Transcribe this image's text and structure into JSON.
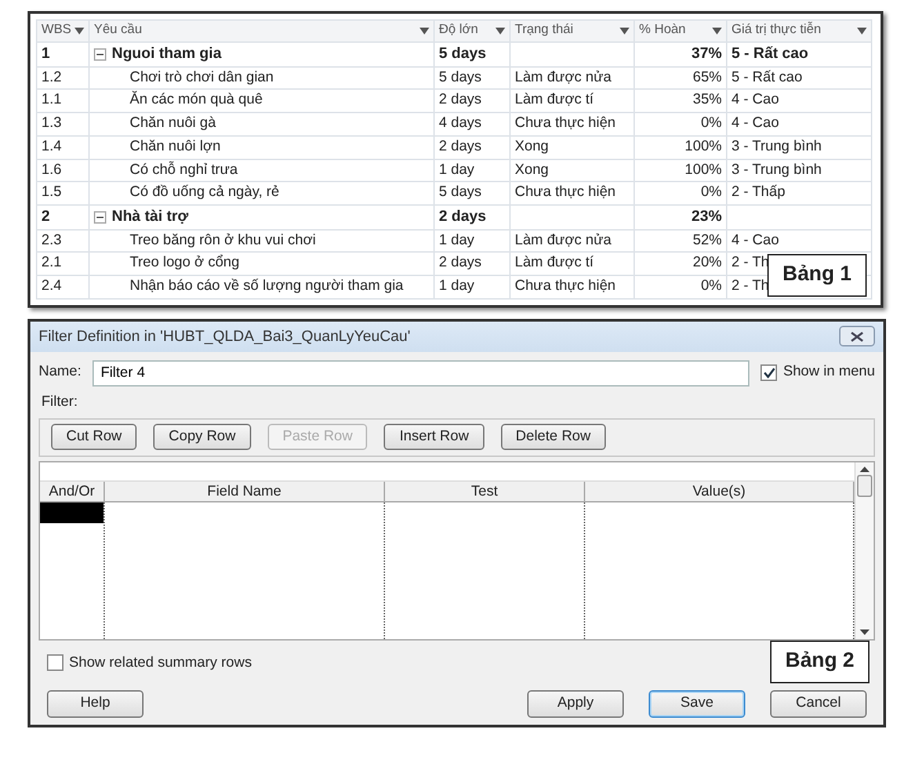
{
  "table": {
    "columns": [
      {
        "label": "WBS"
      },
      {
        "label": "Yêu cầu"
      },
      {
        "label": "Độ lớn"
      },
      {
        "label": "Trạng thái"
      },
      {
        "label": "% Hoàn"
      },
      {
        "label": "Giá trị thực tiễn"
      }
    ],
    "rows": [
      {
        "wbs": "1",
        "name": "Nguoi tham gia",
        "duration": "5 days",
        "complete": "37%",
        "value": "5 - Rất cao",
        "kind": "summary",
        "expanded": true,
        "children": [
          {
            "wbs": "1.2",
            "name": "Chơi trò chơi dân gian",
            "duration": "5 days",
            "status": "Làm được nửa",
            "complete": "65%",
            "value": "5 - Rất cao",
            "kind": "task"
          },
          {
            "wbs": "1.1",
            "name": "Ăn các món quà quê",
            "duration": "2 days",
            "status": "Làm được tí",
            "complete": "35%",
            "value": "4 - Cao",
            "kind": "task"
          },
          {
            "wbs": "1.3",
            "name": "Chăn nuôi gà",
            "duration": "4 days",
            "status": "Chưa thực hiện",
            "complete": "0%",
            "value": "4 - Cao",
            "kind": "task"
          },
          {
            "wbs": "1.4",
            "name": "Chăn nuôi lợn",
            "duration": "2 days",
            "status": "Xong",
            "complete": "100%",
            "value": "3 - Trung bình",
            "kind": "task"
          },
          {
            "wbs": "1.6",
            "name": "Có chỗ nghỉ trưa",
            "duration": "1 day",
            "status": "Xong",
            "complete": "100%",
            "value": "3 - Trung bình",
            "kind": "task"
          },
          {
            "wbs": "1.5",
            "name": "Có đồ uống cả ngày, rẻ",
            "duration": "5 days",
            "status": "Chưa thực hiện",
            "complete": "0%",
            "value": "2 - Thấp",
            "kind": "task"
          }
        ]
      },
      {
        "wbs": "2",
        "name": "Nhà tài trợ",
        "duration": "2 days",
        "complete": "23%",
        "kind": "summary",
        "expanded": true,
        "children": [
          {
            "wbs": "2.3",
            "name": "Treo băng rôn ở khu vui chơi",
            "duration": "1 day",
            "status": "Làm được nửa",
            "complete": "52%",
            "value": "4 - Cao",
            "kind": "task"
          },
          {
            "wbs": "2.1",
            "name": "Treo logo ở cổng",
            "duration": "2 days",
            "status": "Làm được tí",
            "complete": "20%",
            "value": "2 - Th",
            "kind": "task"
          },
          {
            "wbs": "2.4",
            "name": "Nhận báo cáo về số lượng người tham gia",
            "duration": "1 day",
            "status": "Chưa thực hiện",
            "complete": "0%",
            "value": "2 - Th",
            "kind": "task"
          }
        ]
      }
    ],
    "caption": "Bảng 1"
  },
  "dialog": {
    "title": "Filter Definition in 'HUBT_QLDA_Bai3_QuanLyYeuCau'",
    "name_label": "Name:",
    "name_value": "Filter 4",
    "show_in_menu": {
      "label": "Show in menu",
      "checked": true
    },
    "filter_label": "Filter:",
    "toolbar": [
      {
        "label": "Cut Row",
        "disabled": false
      },
      {
        "label": "Copy Row",
        "disabled": false
      },
      {
        "label": "Paste Row",
        "disabled": true
      },
      {
        "label": "Insert Row",
        "disabled": false
      },
      {
        "label": "Delete Row",
        "disabled": false
      }
    ],
    "grid": {
      "columns": [
        "And/Or",
        "Field Name",
        "Test",
        "Value(s)"
      ],
      "rows": [
        {
          "selected": true
        }
      ]
    },
    "show_summary_rows": {
      "label": "Show related summary rows",
      "checked": false
    },
    "buttons": [
      {
        "label": "Help",
        "default": false
      },
      {
        "label": "Apply",
        "default": false
      },
      {
        "label": "Save",
        "default": true
      },
      {
        "label": "Cancel",
        "default": false
      }
    ],
    "caption": "Bảng 2"
  }
}
